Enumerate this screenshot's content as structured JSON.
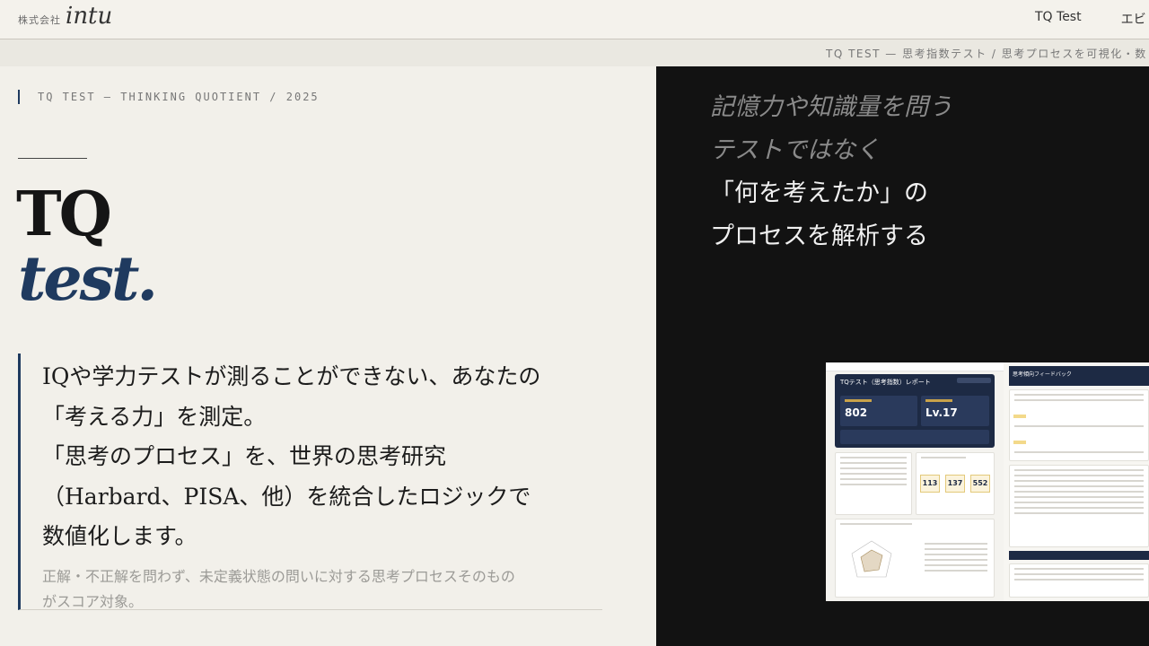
{
  "header": {
    "logo_prefix": "株式会社",
    "logo_name": "intu",
    "nav": [
      "TQ Test",
      "エビ"
    ]
  },
  "breadcrumb": {
    "text": "TQ TEST — 思考指数テスト / 思考プロセスを可視化・数"
  },
  "hero": {
    "eyebrow": "TQ TEST — THINKING QUOTIENT / 2025",
    "title_line1": "TQ",
    "title_line2": "test.",
    "lead_lines": [
      "IQや学力テストが測ることができない、あなたの",
      "「考える力」を測定。",
      "「思考のプロセス」を、世界の思考研究",
      "（Harbard、PISA、他）を統合したロジックで",
      "数値化します。"
    ],
    "note_lines": [
      "正解・不正解を問わず、未定義状態の問いに対する思考プロセスそのもの",
      "がスコア対象。"
    ]
  },
  "tagline": {
    "dim_lines": [
      "記憶力や知識量を問う",
      "テストではなく"
    ],
    "bright_lines": [
      "「何を考えたか」の",
      "プロセスを解析する"
    ]
  },
  "report_preview": {
    "title": "TQテスト（思考指数）レポート",
    "score": "802",
    "level": "Lv.17",
    "scores": [
      "113",
      "137",
      "552"
    ],
    "feedback_title": "思考傾向フィードバック"
  },
  "colors": {
    "accent_navy": "#1f3a5f",
    "dark_panel": "#121212",
    "background": "#f2f0ea"
  }
}
